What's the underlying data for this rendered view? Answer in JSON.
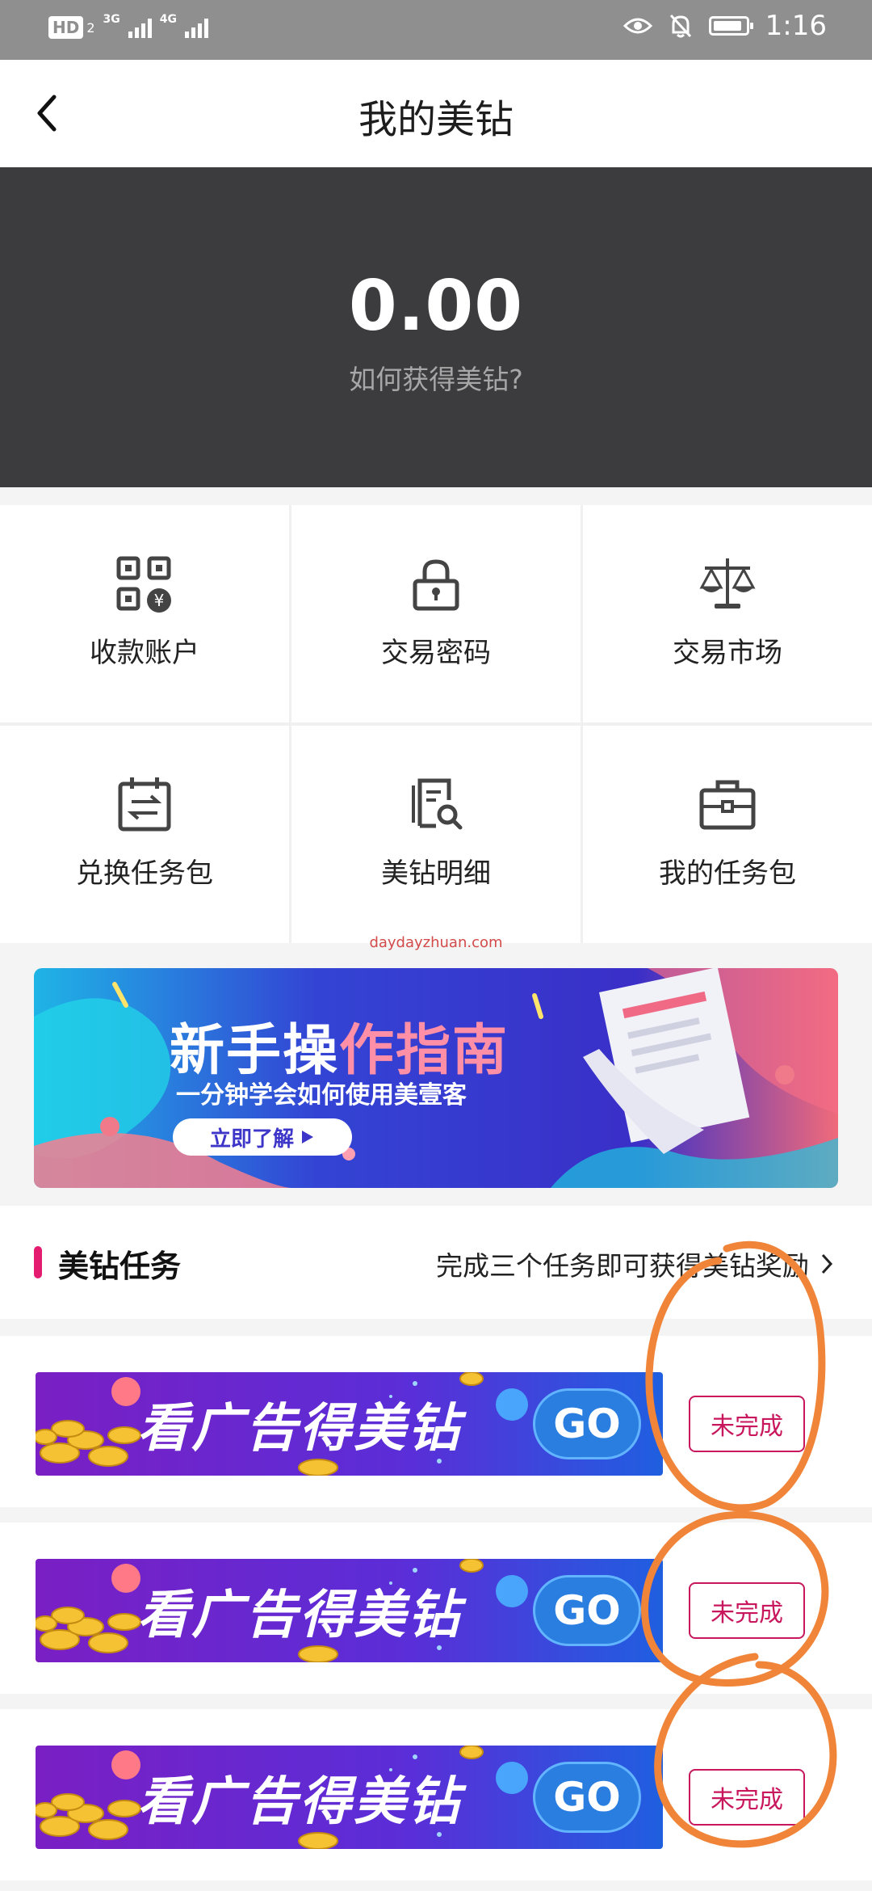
{
  "status_bar": {
    "hd_label": "HD",
    "hd_sub": "2",
    "net1": "3G",
    "net2": "4G",
    "time": "1:16"
  },
  "nav": {
    "title": "我的美钻"
  },
  "balance": {
    "amount": "0.00",
    "howto": "如何获得美钻?"
  },
  "menu": [
    {
      "label": "收款账户",
      "icon": "qr-code-yuan-icon"
    },
    {
      "label": "交易密码",
      "icon": "lock-icon"
    },
    {
      "label": "交易市场",
      "icon": "scale-icon"
    },
    {
      "label": "兑换任务包",
      "icon": "calendar-exchange-icon"
    },
    {
      "label": "美钻明细",
      "icon": "document-search-icon"
    },
    {
      "label": "我的任务包",
      "icon": "briefcase-icon"
    }
  ],
  "watermark": "daydayzhuan.com",
  "guide_banner": {
    "title_a": "新手操",
    "title_b": "作指南",
    "subtitle": "一分钟学会如何使用美壹客",
    "button": "立即了解"
  },
  "tasks": {
    "title": "美钻任务",
    "tip": "完成三个任务即可获得美钻奖励",
    "items": [
      {
        "banner_text": "看广告得美钻",
        "go": "GO",
        "status": "未完成"
      },
      {
        "banner_text": "看广告得美钻",
        "go": "GO",
        "status": "未完成"
      },
      {
        "banner_text": "看广告得美钻",
        "go": "GO",
        "status": "未完成"
      }
    ]
  },
  "colors": {
    "accent": "#e41c6f",
    "status_btn": "#c8175d",
    "hero_bg": "#3c3c3e",
    "annotation": "#f0853a"
  }
}
